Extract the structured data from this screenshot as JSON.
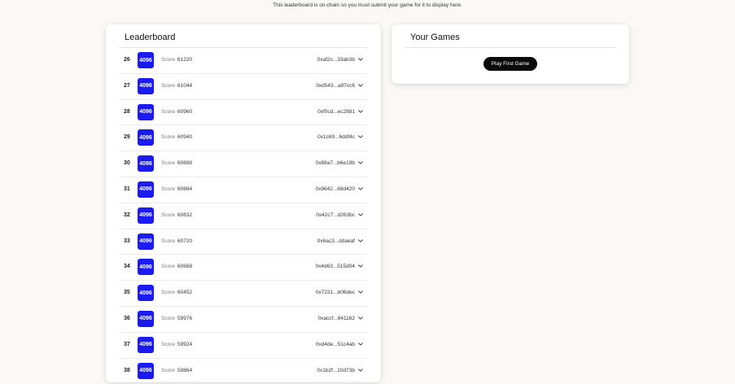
{
  "notice": "This leaderboard is on-chain so you must submit your game for it to display here.",
  "leaderboard": {
    "title": "Leaderboard",
    "score_label": "Score",
    "rows": [
      {
        "rank": "26",
        "tile": "4096",
        "score": "61220",
        "address": "0xaf2c...33ab3b"
      },
      {
        "rank": "27",
        "tile": "4096",
        "score": "61044",
        "address": "0xd543...a97cc6"
      },
      {
        "rank": "28",
        "tile": "4096",
        "score": "60960",
        "address": "0xf0cd...ec2881"
      },
      {
        "rank": "29",
        "tile": "4096",
        "score": "60940",
        "address": "0x1c69...6ddf4c"
      },
      {
        "rank": "30",
        "tile": "4096",
        "score": "60888",
        "address": "0x88a7...b6e19b"
      },
      {
        "rank": "31",
        "tile": "4096",
        "score": "60864",
        "address": "0x9642...68d420"
      },
      {
        "rank": "32",
        "tile": "4096",
        "score": "60832",
        "address": "0x42c7...d263bc"
      },
      {
        "rank": "33",
        "tile": "4096",
        "score": "60720",
        "address": "0x6ac3...ddaeaf"
      },
      {
        "rank": "34",
        "tile": "4096",
        "score": "60668",
        "address": "0x4d63...515d04"
      },
      {
        "rank": "35",
        "tile": "4096",
        "score": "60452",
        "address": "0x7231...b06dec"
      },
      {
        "rank": "36",
        "tile": "4096",
        "score": "59976",
        "address": "0xaccf...841162"
      },
      {
        "rank": "37",
        "tile": "4096",
        "score": "59924",
        "address": "0xd4de...51c4ab"
      },
      {
        "rank": "38",
        "tile": "4096",
        "score": "59864",
        "address": "0x1b2f...10d73b"
      }
    ]
  },
  "games": {
    "title": "Your Games",
    "play_button": "Play First Game"
  },
  "colors": {
    "tile_blue": "#1a1af2",
    "button_black": "#0a0a0a",
    "background": "#faf9f7"
  },
  "icons": {
    "row_expand": "chevron-down-icon"
  }
}
